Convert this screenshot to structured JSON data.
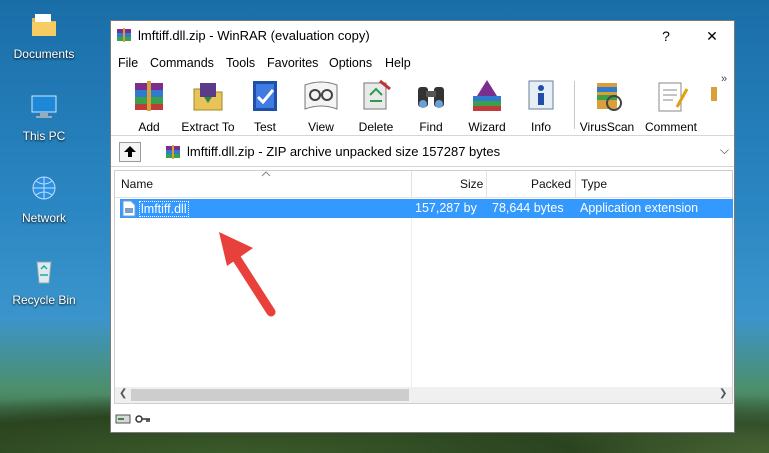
{
  "desktop": {
    "icons": [
      {
        "label": "Documents",
        "icon": "documents-folder-icon"
      },
      {
        "label": "This PC",
        "icon": "computer-icon"
      },
      {
        "label": "Network",
        "icon": "network-icon"
      },
      {
        "label": "Recycle Bin",
        "icon": "recycle-bin-icon"
      }
    ]
  },
  "window": {
    "title": "lmftiff.dll.zip - WinRAR (evaluation copy)",
    "help_button": "?",
    "close_button": "✕"
  },
  "menu": [
    "File",
    "Commands",
    "Tools",
    "Favorites",
    "Options",
    "Help"
  ],
  "toolbar": [
    {
      "label": "Add",
      "icon": "add-archive-icon"
    },
    {
      "label": "Extract To",
      "icon": "extract-to-icon"
    },
    {
      "label": "Test",
      "icon": "test-icon"
    },
    {
      "label": "View",
      "icon": "view-icon"
    },
    {
      "label": "Delete",
      "icon": "delete-icon"
    },
    {
      "label": "Find",
      "icon": "find-icon"
    },
    {
      "label": "Wizard",
      "icon": "wizard-icon"
    },
    {
      "label": "Info",
      "icon": "info-icon"
    },
    {
      "label": "VirusScan",
      "icon": "virusscan-icon"
    },
    {
      "label": "Comment",
      "icon": "comment-icon"
    }
  ],
  "toolbar_more": "»",
  "path": {
    "text": "lmftiff.dll.zip - ZIP archive unpacked size 157287 bytes",
    "dropdown": "⌵"
  },
  "columns": {
    "name": "Name",
    "size": "Size",
    "packed": "Packed",
    "type": "Type"
  },
  "files": [
    {
      "name": "lmftiff.dll",
      "size": "157,287 by",
      "packed": "78,644 bytes",
      "type": "Application extension",
      "selected": true
    }
  ],
  "scroll": {
    "left": "❮",
    "right": "❯"
  },
  "colors": {
    "selection": "#3399ff",
    "annotation_arrow": "#e8403a"
  }
}
